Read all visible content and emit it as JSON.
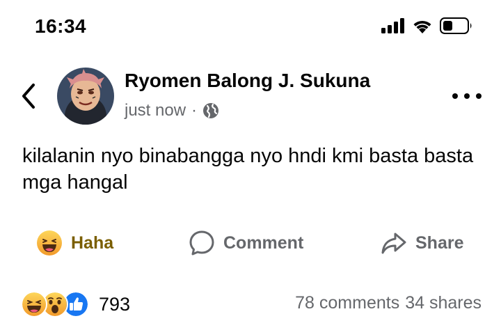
{
  "status_bar": {
    "time": "16:34"
  },
  "post": {
    "author": "Ryomen Balong J. Sukuna",
    "timestamp": "just now",
    "separator": "·",
    "privacy_icon": "globe-icon",
    "text": "kilalanin nyo binabangga nyo hndi kmi basta basta mga hangal"
  },
  "actions": {
    "reaction_label": "Haha",
    "comment_label": "Comment",
    "share_label": "Share"
  },
  "footer": {
    "reaction_icons": [
      "haha-icon",
      "wow-icon",
      "like-icon"
    ],
    "reaction_count": "793",
    "comments": "78 comments",
    "shares": "34 shares"
  },
  "colors": {
    "text": "#050505",
    "secondary": "#65676b",
    "haha_label": "#7a5e00",
    "like_blue": "#1877f2",
    "emoji_yellow": "#f7b125"
  }
}
